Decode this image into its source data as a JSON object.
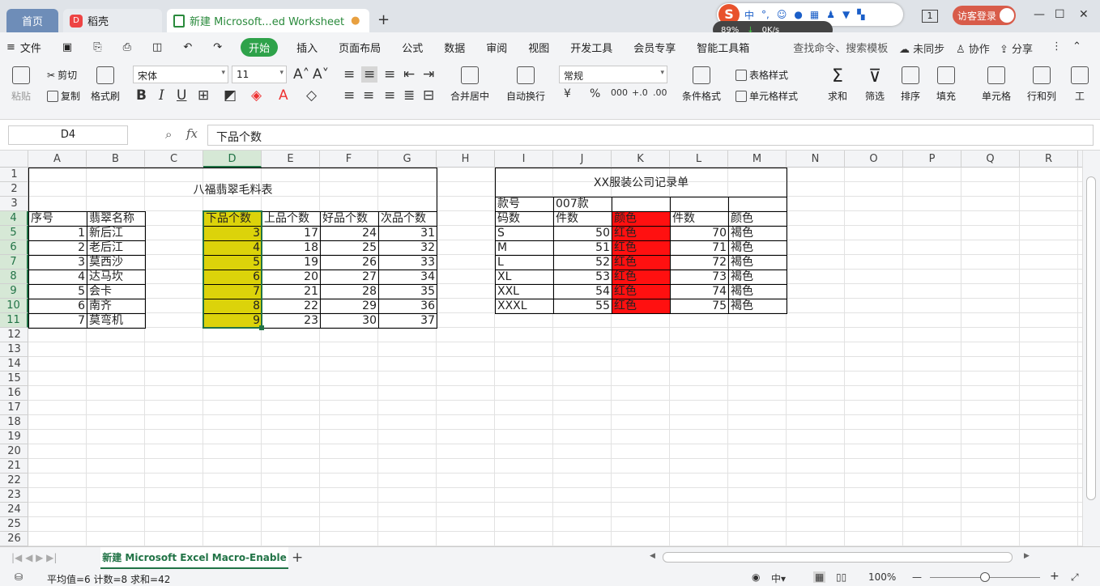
{
  "tabs": {
    "home": "首页",
    "daoke": "稻壳",
    "workbook": "新建 Microsoft...ed Worksheet"
  },
  "ime": {
    "logo": "S",
    "lang": "中",
    "punct": "°,",
    "speed_pct": "89%",
    "net": "0K/s"
  },
  "window": {
    "page_num": "1",
    "login": "访客登录"
  },
  "menu": {
    "file": "文件",
    "items": [
      "开始",
      "插入",
      "页面布局",
      "公式",
      "数据",
      "审阅",
      "视图",
      "开发工具",
      "会员专享",
      "智能工具箱"
    ],
    "search": "查找命令、搜索模板",
    "unsynced": "未同步",
    "collab": "协作",
    "share": "分享"
  },
  "ribbon": {
    "paste": "粘贴",
    "cut": "剪切",
    "copy": "复制",
    "format_painter": "格式刷",
    "font_name": "宋体",
    "font_size": "11",
    "merge": "合并居中",
    "wrap": "自动换行",
    "number_format": "常规",
    "cond_format": "条件格式",
    "table_style": "表格样式",
    "cell_style": "单元格样式",
    "sum": "求和",
    "filter": "筛选",
    "sort": "排序",
    "fill": "填充",
    "cells": "单元格",
    "rowcol": "行和列",
    "worksheet": "工"
  },
  "formula": {
    "cell_ref": "D4",
    "fx": "fx",
    "content": "下品个数"
  },
  "grid": {
    "columns": [
      "A",
      "B",
      "C",
      "D",
      "E",
      "F",
      "G",
      "H",
      "I",
      "J",
      "K",
      "L",
      "M",
      "N",
      "O",
      "P",
      "Q",
      "R"
    ],
    "rows": [
      "1",
      "2",
      "3",
      "4",
      "5",
      "6",
      "7",
      "8",
      "9",
      "10",
      "11",
      "12",
      "13",
      "14",
      "15",
      "16",
      "17",
      "18",
      "19",
      "20",
      "21",
      "22",
      "23",
      "24",
      "25",
      "26"
    ],
    "selected_col": "D",
    "selected_rows": [
      "4",
      "5",
      "6",
      "7",
      "8",
      "9",
      "10",
      "11"
    ]
  },
  "table1": {
    "title": "八福翡翠毛料表",
    "headers": [
      "序号",
      "翡翠名称",
      "",
      "下品个数",
      "上品个数",
      "好品个数",
      "次品个数"
    ],
    "rows": [
      [
        "1",
        "新后江",
        "",
        "3",
        "17",
        "24",
        "31"
      ],
      [
        "2",
        "老后江",
        "",
        "4",
        "18",
        "25",
        "32"
      ],
      [
        "3",
        "莫西沙",
        "",
        "5",
        "19",
        "26",
        "33"
      ],
      [
        "4",
        "达马坎",
        "",
        "6",
        "20",
        "27",
        "34"
      ],
      [
        "5",
        "会卡",
        "",
        "7",
        "21",
        "28",
        "35"
      ],
      [
        "6",
        "南齐",
        "",
        "8",
        "22",
        "29",
        "36"
      ],
      [
        "7",
        "莫弯机",
        "",
        "9",
        "23",
        "30",
        "37"
      ]
    ]
  },
  "table2": {
    "title": "XX服装公司记录单",
    "style_label": "款号",
    "style_value": "007款",
    "headers": [
      "码数",
      "件数",
      "颜色",
      "件数",
      "颜色"
    ],
    "rows": [
      [
        "S",
        "50",
        "红色",
        "70",
        "褐色"
      ],
      [
        "M",
        "51",
        "红色",
        "71",
        "褐色"
      ],
      [
        "L",
        "52",
        "红色",
        "72",
        "褐色"
      ],
      [
        "XL",
        "53",
        "红色",
        "73",
        "褐色"
      ],
      [
        "XXL",
        "54",
        "红色",
        "74",
        "褐色"
      ],
      [
        "XXXL",
        "55",
        "红色",
        "75",
        "褐色"
      ]
    ]
  },
  "sheet": {
    "name": "新建 Microsoft Excel Macro-Enable"
  },
  "status": {
    "summary": "平均值=6  计数=8  求和=42",
    "zoom": "100%"
  },
  "colors": {
    "accent": "#217346",
    "red": "#ff1010",
    "yellow": "#dcd30a",
    "start_tab": "#2ea24a"
  }
}
